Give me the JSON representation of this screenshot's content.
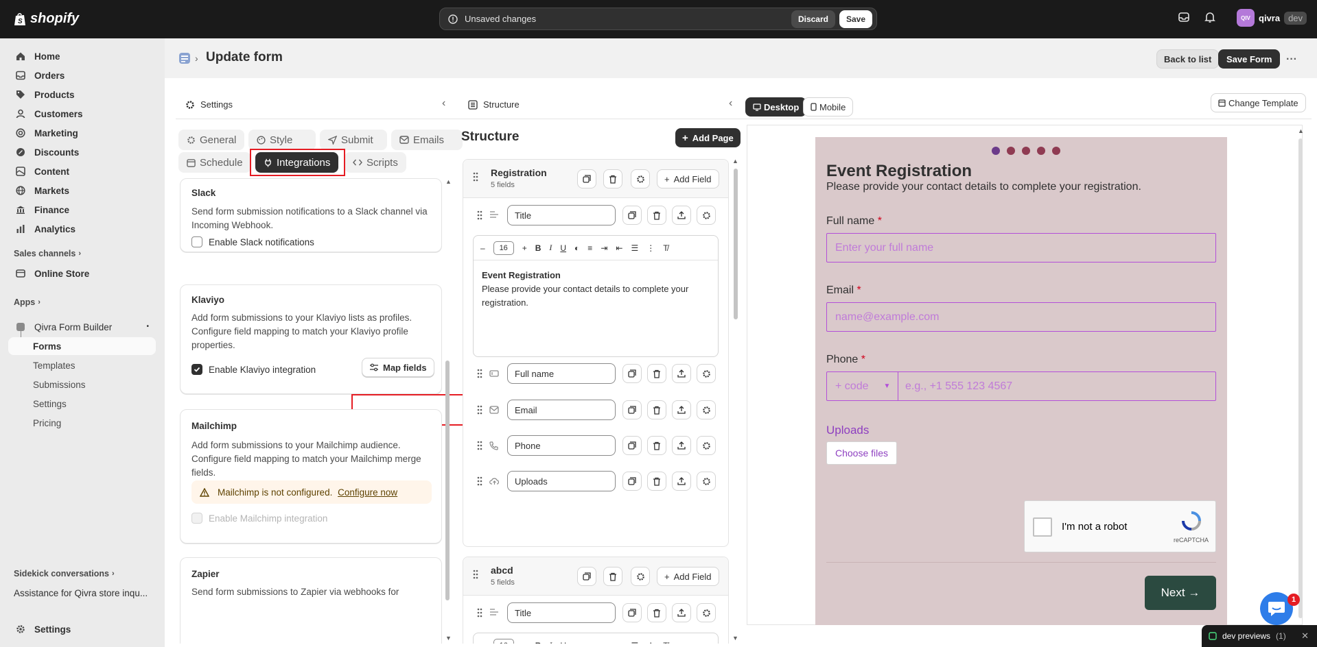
{
  "topbar": {
    "brand": "shopify",
    "unsaved_text": "Unsaved changes",
    "discard_label": "Discard",
    "save_label": "Save",
    "avatar_initials": "QIV",
    "store_name": "qivra",
    "env_badge": "dev"
  },
  "sidebar": {
    "items": [
      {
        "label": "Home",
        "icon": "home-icon"
      },
      {
        "label": "Orders",
        "icon": "orders-icon"
      },
      {
        "label": "Products",
        "icon": "tag-icon"
      },
      {
        "label": "Customers",
        "icon": "person-icon"
      },
      {
        "label": "Marketing",
        "icon": "target-icon"
      },
      {
        "label": "Discounts",
        "icon": "discount-icon"
      },
      {
        "label": "Content",
        "icon": "content-icon"
      },
      {
        "label": "Markets",
        "icon": "globe-icon"
      },
      {
        "label": "Finance",
        "icon": "bank-icon"
      },
      {
        "label": "Analytics",
        "icon": "chart-icon"
      }
    ],
    "sales_channels_label": "Sales channels",
    "online_store_label": "Online Store",
    "apps_label": "Apps",
    "app_name": "Qivra Form Builder",
    "app_subitems": [
      "Forms",
      "Templates",
      "Submissions",
      "Settings",
      "Pricing"
    ],
    "sidekick_label": "Sidekick conversations",
    "sidekick_item": "Assistance for Qivra store inqu...",
    "settings_label": "Settings"
  },
  "header": {
    "title": "Update form",
    "back_label": "Back to list",
    "save_form_label": "Save Form",
    "more_label": "···"
  },
  "settings_panel": {
    "title": "Settings",
    "tabs": [
      "General",
      "Style",
      "Submit",
      "Emails",
      "Schedule",
      "Integrations",
      "Scripts"
    ],
    "active_tab": "Integrations",
    "slack": {
      "title": "Slack",
      "desc": "Send form submission notifications to a Slack channel via Incoming Webhook.",
      "checkbox_label": "Enable Slack notifications"
    },
    "klaviyo": {
      "title": "Klaviyo",
      "desc": "Add form submissions to your Klaviyo lists as profiles. Configure field mapping to match your Klaviyo profile properties.",
      "checkbox_label": "Enable Klaviyo integration",
      "map_label": "Map fields"
    },
    "mailchimp": {
      "title": "Mailchimp",
      "desc": "Add form submissions to your Mailchimp audience. Configure field mapping to match your Mailchimp merge fields.",
      "warning": "Mailchimp is not configured.",
      "configure_label": "Configure now",
      "checkbox_label": "Enable Mailchimp integration"
    },
    "zapier": {
      "title": "Zapier",
      "desc": "Send form submissions to Zapier via webhooks for powerful automation workflows."
    }
  },
  "structure_panel": {
    "title": "Structure",
    "heading": "Structure",
    "add_page_label": "Add Page",
    "add_field_label": "Add Field",
    "pages": [
      {
        "name": "Registration",
        "count": "5 fields",
        "fields": [
          "Title",
          "Full name",
          "Email",
          "Phone",
          "Uploads"
        ]
      },
      {
        "name": "abcd",
        "count": "5 fields",
        "fields": [
          "Title"
        ]
      }
    ],
    "editor": {
      "font_size": "16",
      "heading": "Event Registration",
      "body": "Please provide your contact details to complete your registration."
    }
  },
  "preview": {
    "desktop_label": "Desktop",
    "mobile_label": "Mobile",
    "change_template_label": "Change Template",
    "form_title": "Event Registration",
    "form_subtitle": "Please provide your contact details to complete your registration.",
    "fields": [
      {
        "label": "Full name",
        "placeholder": "Enter your full name"
      },
      {
        "label": "Email",
        "placeholder": "name@example.com"
      },
      {
        "label": "Phone",
        "code_placeholder": "+ code",
        "placeholder": "e.g., +1 555 123 4567"
      }
    ],
    "required_mark": "*",
    "uploads_label": "Uploads",
    "choose_files_label": "Choose files",
    "recaptcha_label": "I'm not a robot",
    "recaptcha_brand": "reCAPTCHA",
    "next_label": "Next →",
    "step_count": 5
  },
  "footer": {
    "chat_badge": "1",
    "dev_previews_label": "dev previews",
    "dev_previews_count": "(1)"
  },
  "colors": {
    "topbar": "#1a1a1a",
    "form_bg": "#dac9cb",
    "accent_purple": "#b34fd9",
    "next_button": "#2b4a40",
    "highlight_red": "#e51c23"
  }
}
